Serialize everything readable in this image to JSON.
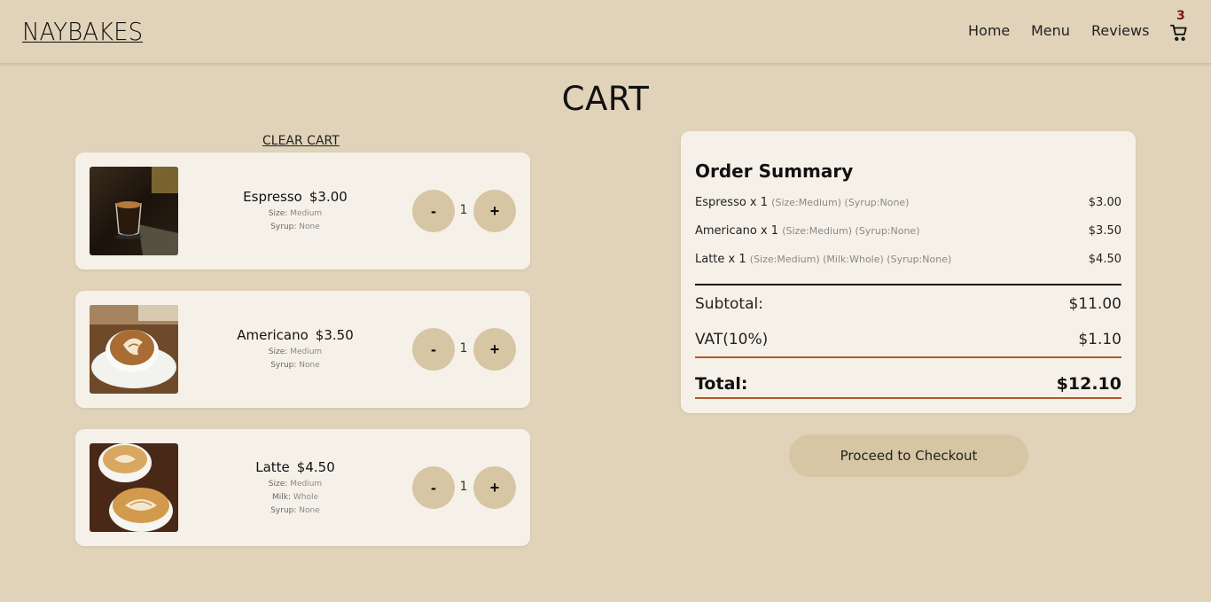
{
  "header": {
    "logo": "NAYBAKES",
    "nav": [
      "Home",
      "Menu",
      "Reviews"
    ],
    "cart_count": "3"
  },
  "page_title": "CART",
  "clear_cart": "CLEAR CART",
  "items": [
    {
      "name": "Espresso",
      "price": "$3.00",
      "options": [
        {
          "label": "Size:",
          "value": "Medium"
        },
        {
          "label": "Syrup:",
          "value": "None"
        }
      ],
      "qty": "1"
    },
    {
      "name": "Americano",
      "price": "$3.50",
      "options": [
        {
          "label": "Size:",
          "value": "Medium"
        },
        {
          "label": "Syrup:",
          "value": "None"
        }
      ],
      "qty": "1"
    },
    {
      "name": "Latte",
      "price": "$4.50",
      "options": [
        {
          "label": "Size:",
          "value": "Medium"
        },
        {
          "label": "Milk:",
          "value": "Whole"
        },
        {
          "label": "Syrup:",
          "value": "None"
        }
      ],
      "qty": "1"
    }
  ],
  "buttons": {
    "minus": "-",
    "plus": "+"
  },
  "summary": {
    "title": "Order Summary",
    "lines": [
      {
        "item": "Espresso x 1",
        "meta": "(Size:Medium) (Syrup:None)",
        "amount": "$3.00"
      },
      {
        "item": "Americano x 1",
        "meta": "(Size:Medium) (Syrup:None)",
        "amount": "$3.50"
      },
      {
        "item": "Latte x 1",
        "meta": "(Size:Medium) (Milk:Whole) (Syrup:None)",
        "amount": "$4.50"
      }
    ],
    "subtotal_label": "Subtotal:",
    "subtotal": "$11.00",
    "vat_label": "VAT(10%)",
    "vat": "$1.10",
    "total_label": "Total:",
    "total": "$12.10"
  },
  "checkout_label": "Proceed to Checkout",
  "colors": {
    "background": "#e0d3b9",
    "card": "#f6f1e8",
    "button": "#d6c6a4",
    "accent_line": "#b3562a",
    "badge": "#7a1717"
  }
}
